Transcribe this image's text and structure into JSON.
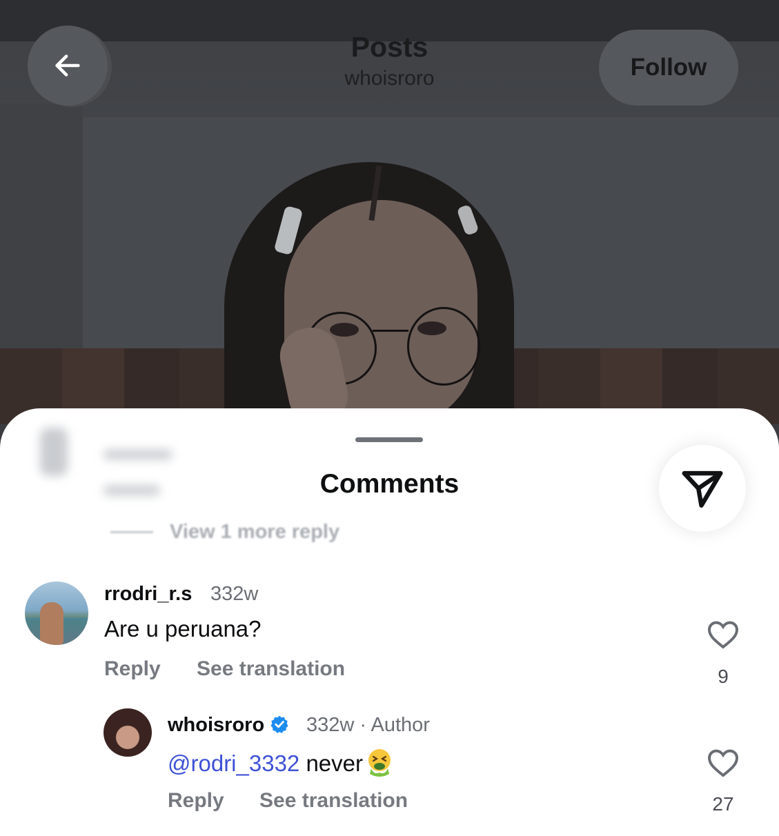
{
  "header": {
    "title": "Posts",
    "subtitle": "whoisroro",
    "follow_label": "Follow"
  },
  "sheet": {
    "title": "Comments",
    "view_more_replies": "View 1 more reply"
  },
  "comments": [
    {
      "username": "rrodri_r.s",
      "time": "332w",
      "text": "Are u peruana?",
      "reply_label": "Reply",
      "translate_label": "See translation",
      "likes": "9"
    },
    {
      "username": "whoisroro",
      "verified": true,
      "time": "332w · Author",
      "mention": "@rodri_3332",
      "text": " never",
      "emoji": "nauseated-face-icon",
      "reply_label": "Reply",
      "translate_label": "See translation",
      "likes": "27"
    }
  ],
  "colors": {
    "mention": "#3f51d6",
    "verified": "#1d8cf0",
    "sheet_bg": "#ffffff"
  },
  "icons": {
    "back": "arrow-left-icon",
    "share": "paper-plane-icon",
    "like": "heart-icon"
  }
}
